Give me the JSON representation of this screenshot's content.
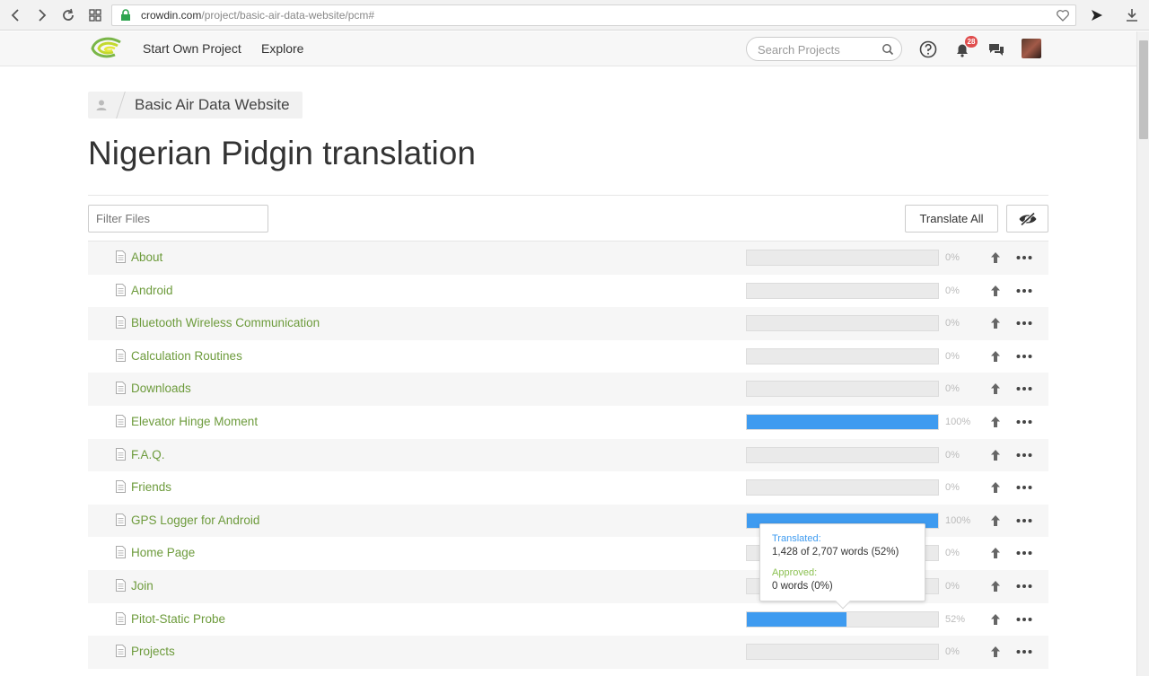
{
  "browser": {
    "url_host": "crowdin.com",
    "url_path": "/project/basic-air-data-website/pcm#"
  },
  "header": {
    "nav": [
      "Start Own Project",
      "Explore"
    ],
    "search_placeholder": "Search Projects",
    "notification_count": "28"
  },
  "breadcrumb": {
    "project": "Basic Air Data Website"
  },
  "page": {
    "title": "Nigerian Pidgin translation",
    "filter_placeholder": "Filter Files",
    "translate_all_label": "Translate All"
  },
  "files": [
    {
      "name": "About",
      "pct_label": "0%",
      "progress": 0
    },
    {
      "name": "Android",
      "pct_label": "0%",
      "progress": 0
    },
    {
      "name": "Bluetooth Wireless Communication",
      "pct_label": "0%",
      "progress": 0
    },
    {
      "name": "Calculation Routines",
      "pct_label": "0%",
      "progress": 0
    },
    {
      "name": "Downloads",
      "pct_label": "0%",
      "progress": 0
    },
    {
      "name": "Elevator Hinge Moment",
      "pct_label": "100%",
      "progress": 100
    },
    {
      "name": "F.A.Q.",
      "pct_label": "0%",
      "progress": 0
    },
    {
      "name": "Friends",
      "pct_label": "0%",
      "progress": 0
    },
    {
      "name": "GPS Logger for Android",
      "pct_label": "100%",
      "progress": 100
    },
    {
      "name": "Home Page",
      "pct_label": "0%",
      "progress": 0
    },
    {
      "name": "Join",
      "pct_label": "0%",
      "progress": 0
    },
    {
      "name": "Pitot-Static Probe",
      "pct_label": "52%",
      "progress": 52
    },
    {
      "name": "Projects",
      "pct_label": "0%",
      "progress": 0
    }
  ],
  "tooltip": {
    "translated_label": "Translated:",
    "translated_value": "1,428 of 2,707 words (52%)",
    "approved_label": "Approved:",
    "approved_value": "0 words (0%)"
  },
  "colors": {
    "file_link": "#6d9b3c",
    "progress_fill": "#3e9bf0",
    "translated_label": "#3e9bf0",
    "approved_label": "#8cc152",
    "badge": "#e04d4d"
  }
}
